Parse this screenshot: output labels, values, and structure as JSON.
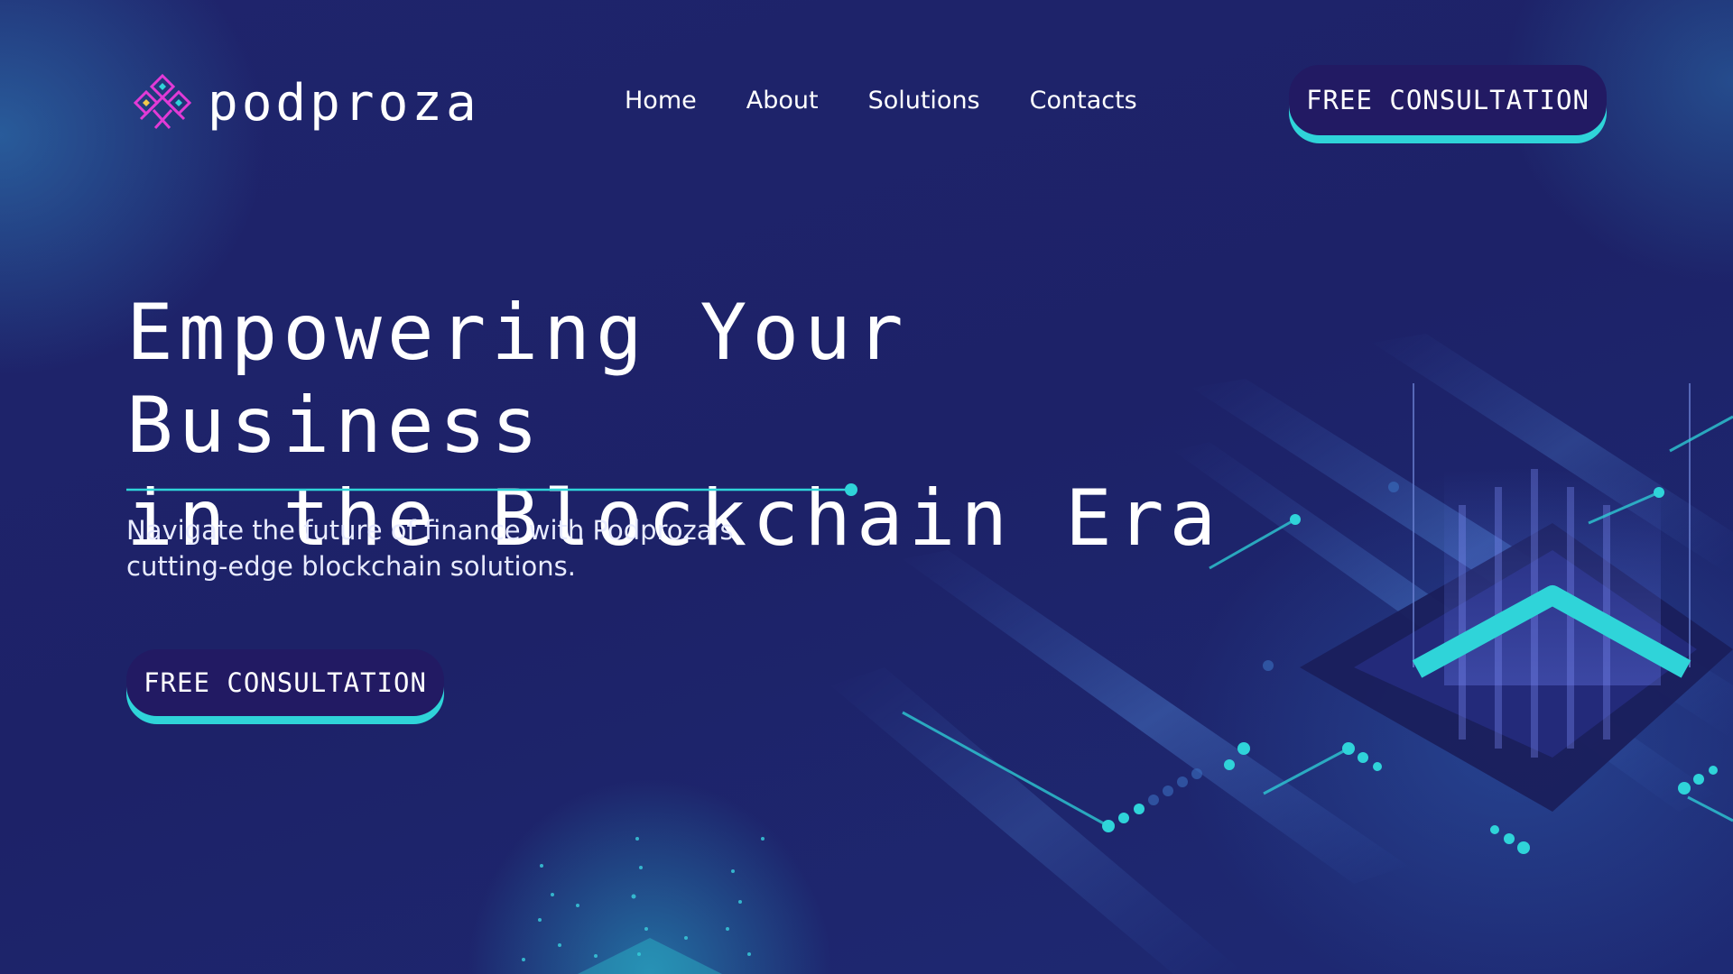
{
  "brand": {
    "name": "podproza"
  },
  "nav": {
    "items": [
      {
        "label": "Home"
      },
      {
        "label": "About"
      },
      {
        "label": "Solutions"
      },
      {
        "label": "Contacts"
      }
    ]
  },
  "header": {
    "cta_label": "FREE CONSULTATION"
  },
  "hero": {
    "title_line1": "Empowering Your Business",
    "title_line2": "in the Blockchain Era",
    "subtitle_line1": "Navigate the future of finance with Podproza's",
    "subtitle_line2": "cutting-edge blockchain solutions.",
    "cta_label": "FREE CONSULTATION"
  },
  "icons": {
    "logo": "diamond-knot-logo-icon",
    "divider_dot": "dot-icon"
  },
  "colors": {
    "background": "#1d2268",
    "accent": "#2fd4d9",
    "button": "#221a63",
    "logo_pink": "#e23ad6",
    "text": "#ffffff"
  }
}
